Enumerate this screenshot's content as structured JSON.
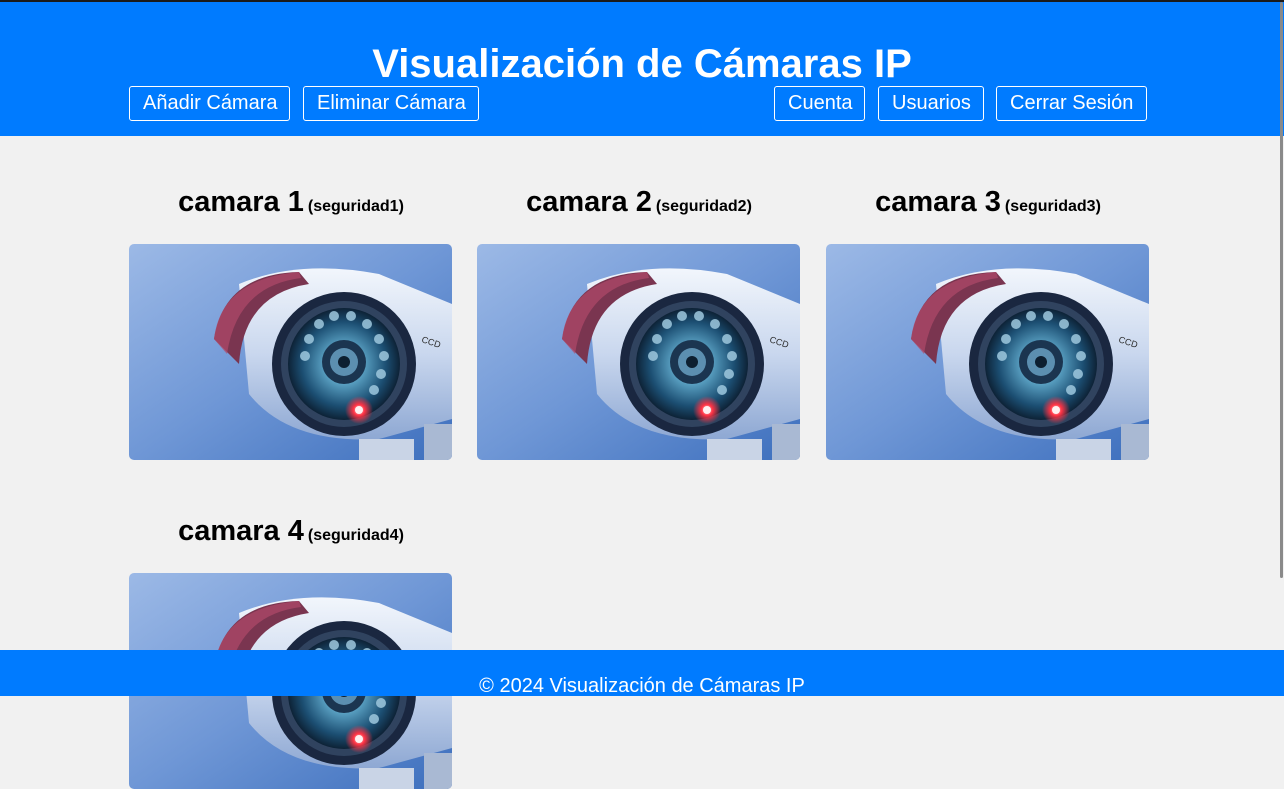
{
  "header": {
    "title": "Visualización de Cámaras IP",
    "left_buttons": [
      "Añadir Cámara",
      "Eliminar Cámara"
    ],
    "right_buttons": [
      "Cuenta",
      "Usuarios",
      "Cerrar Sesión"
    ]
  },
  "cameras": [
    {
      "name": "camara 1",
      "id": "(seguridad1)",
      "image": "security-camera-photo"
    },
    {
      "name": "camara 2",
      "id": "(seguridad2)",
      "image": "security-camera-photo"
    },
    {
      "name": "camara 3",
      "id": "(seguridad3)",
      "image": "security-camera-photo"
    },
    {
      "name": "camara 4",
      "id": "(seguridad4)",
      "image": "security-camera-photo"
    }
  ],
  "footer": {
    "text": "© 2024 Visualización de Cámaras IP"
  },
  "colors": {
    "primary": "#007bff",
    "background": "#f1f1f1"
  }
}
